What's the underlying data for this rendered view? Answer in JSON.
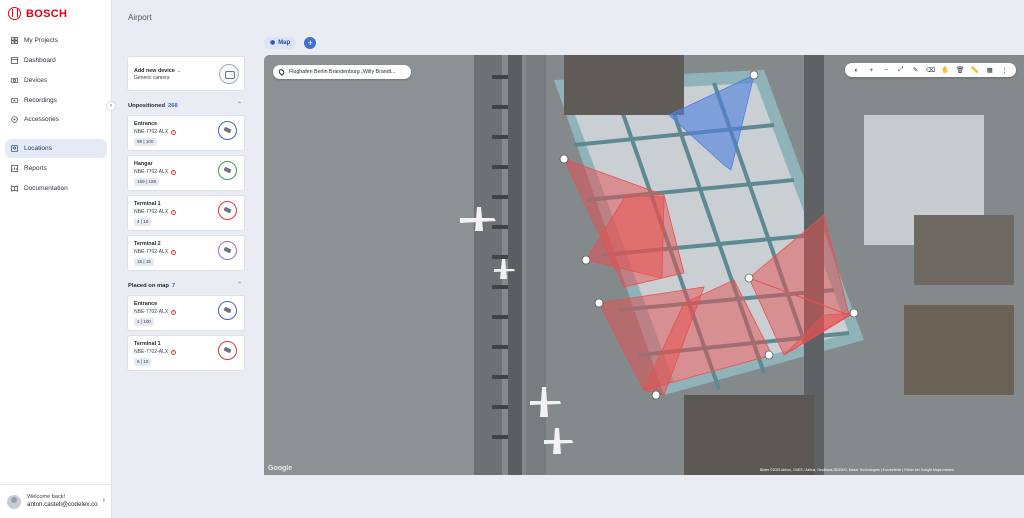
{
  "brand": {
    "name": "BOSCH"
  },
  "nav": [
    {
      "label": "My Projects",
      "icon": "grid-icon"
    },
    {
      "label": "Dashboard",
      "icon": "dashboard-icon"
    },
    {
      "label": "Devices",
      "icon": "camera-icon"
    },
    {
      "label": "Recordings",
      "icon": "recordings-icon"
    },
    {
      "label": "Accessories",
      "icon": "accessories-icon"
    },
    {
      "label": "Locations",
      "icon": "location-icon",
      "active": true
    },
    {
      "label": "Reports",
      "icon": "reports-icon"
    },
    {
      "label": "Documentation",
      "icon": "book-icon"
    }
  ],
  "user": {
    "greeting": "Welcome back!",
    "email": "anton.castell@codelex.co"
  },
  "page": {
    "title": "Airport"
  },
  "add_device": {
    "title": "Add new device",
    "subtitle": "Generic camera"
  },
  "unpositioned": {
    "label": "Unpositioned",
    "count": "268",
    "items": [
      {
        "name": "Entrance",
        "model": "NBE-7702-ALX",
        "badge": "99 | 100",
        "ring": "#3f63c7"
      },
      {
        "name": "Hangar",
        "model": "NBE-7702-ALX",
        "badge": "169 | 169",
        "ring": "#3f9a5a"
      },
      {
        "name": "Terminal 1",
        "model": "NBE-7702-ALX",
        "badge": "4 | 10",
        "ring": "#d93a3a"
      },
      {
        "name": "Terminal 2",
        "model": "NBE-7702-ALX",
        "badge": "15 | 15",
        "ring": "#9a6ad0"
      }
    ]
  },
  "placed": {
    "label": "Placed on map",
    "count": "7",
    "items": [
      {
        "name": "Entrance",
        "model": "NBE-7702-ALX",
        "badge": "1 | 100",
        "ring": "#3f63c7"
      },
      {
        "name": "Terminal 1",
        "model": "NBE-7702-ALX",
        "badge": "6 | 10",
        "ring": "#d93a3a"
      }
    ]
  },
  "map": {
    "tab_label": "Map",
    "search_value": "Flughafen Berlin Brandenburg „Willy Brandt...",
    "attribution": "Bilder ©2025 Airbus, CNES / Airbus, GeoBasis-DE/BKG, Maxar Technologies  |  Kurzbefehle  |  Fehler bei Google Maps melden",
    "google_label": "Google",
    "toolbar_icons": [
      "layers-icon",
      "zoom-in-icon",
      "zoom-out-icon",
      "fit-icon",
      "pen-icon",
      "eraser-icon",
      "hand-icon",
      "trash-icon",
      "ruler-icon",
      "grid-icon",
      "more-icon"
    ],
    "toolbar_glyphs": [
      "◐",
      "+",
      "−",
      "⤢",
      "✎",
      "⌫",
      "✋",
      "🗑",
      "📏",
      "▦",
      "⋮"
    ],
    "fov_colors": {
      "red": "#e8504f",
      "blue": "#4f7ee0"
    }
  }
}
